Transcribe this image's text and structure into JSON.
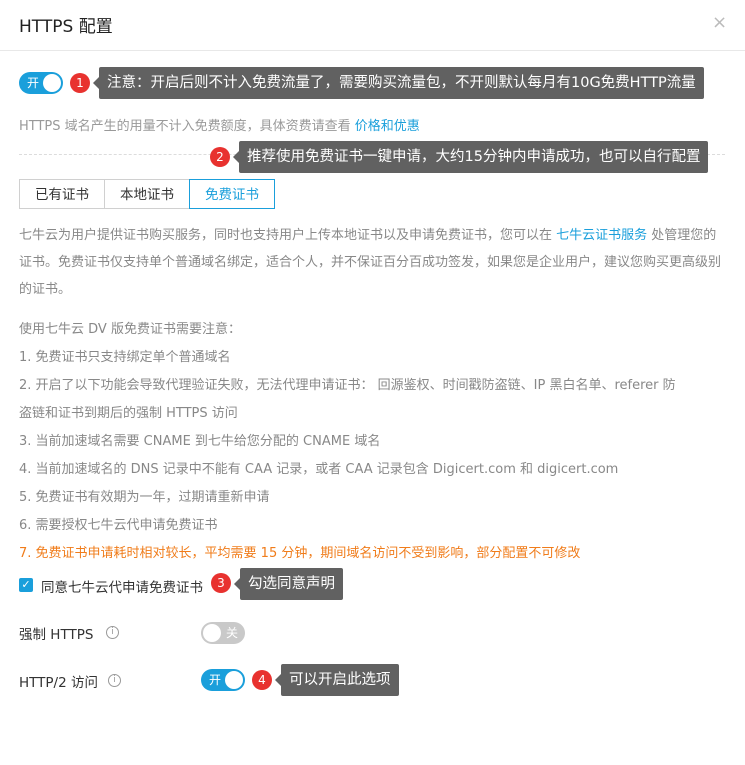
{
  "dialog": {
    "title": "HTTPS 配置",
    "close_symbol": "×"
  },
  "https_toggle": {
    "state": "on",
    "label": "开"
  },
  "callouts": {
    "c1": {
      "number": "1",
      "text": "注意：开启后则不计入免费流量了，需要购买流量包，不开则默认每月有10G免费HTTP流量"
    },
    "c2": {
      "number": "2",
      "text": "推荐使用免费证书一键申请，大约15分钟内申请成功，也可以自行配置"
    },
    "c3": {
      "number": "3",
      "text": "勾选同意声明"
    },
    "c4": {
      "number": "4",
      "text": "可以开启此选项"
    }
  },
  "billing_note": {
    "text": "HTTPS 域名产生的用量不计入免费额度，具体资费请查看 ",
    "link": "价格和优惠"
  },
  "tabs": [
    {
      "label": "已有证书",
      "active": false
    },
    {
      "label": "本地证书",
      "active": false
    },
    {
      "label": "免费证书",
      "active": true
    }
  ],
  "intro": {
    "before_link": "七牛云为用户提供证书购买服务，同时也支持用户上传本地证书以及申请免费证书，您可以在 ",
    "link": "七牛云证书服务",
    "after_link": " 处管理您的证书。免费证书仅支持单个普通域名绑定，适合个人，并不保证百分百成功签发，如果您是企业用户，建议您购买更高级别的证书。"
  },
  "notes": {
    "heading": "使用七牛云 DV 版免费证书需要注意：",
    "items": [
      "1. 免费证书只支持绑定单个普通域名",
      "2. 开启了以下功能会导致代理验证失败，无法代理申请证书： 回源鉴权、时间戳防盗链、IP 黑白名单、referer 防",
      "盗链和证书到期后的强制 HTTPS 访问",
      "3. 当前加速域名需要 CNAME 到七牛给您分配的 CNAME 域名",
      "4. 当前加速域名的 DNS 记录中不能有 CAA 记录，或者 CAA 记录包含 Digicert.com 和 digicert.com",
      "5. 免费证书有效期为一年，过期请重新申请",
      "6. 需要授权七牛云代申请免费证书"
    ],
    "warning": "7. 免费证书申请耗时相对较长，平均需要 15 分钟，期间域名访问不受到影响，部分配置不可修改"
  },
  "agreement": {
    "checked": true,
    "check_symbol": "✓",
    "label": "同意七牛云代申请免费证书"
  },
  "force_https": {
    "label": "强制 HTTPS",
    "info_symbol": "i",
    "state": "off",
    "toggle_label": "关"
  },
  "http2": {
    "label": "HTTP/2 访问",
    "info_symbol": "i",
    "state": "on",
    "toggle_label": "开"
  },
  "colors": {
    "accent": "#1a9fdb",
    "badge": "#e8322f",
    "callout_bg": "#616161",
    "warning": "#f07c1a"
  }
}
